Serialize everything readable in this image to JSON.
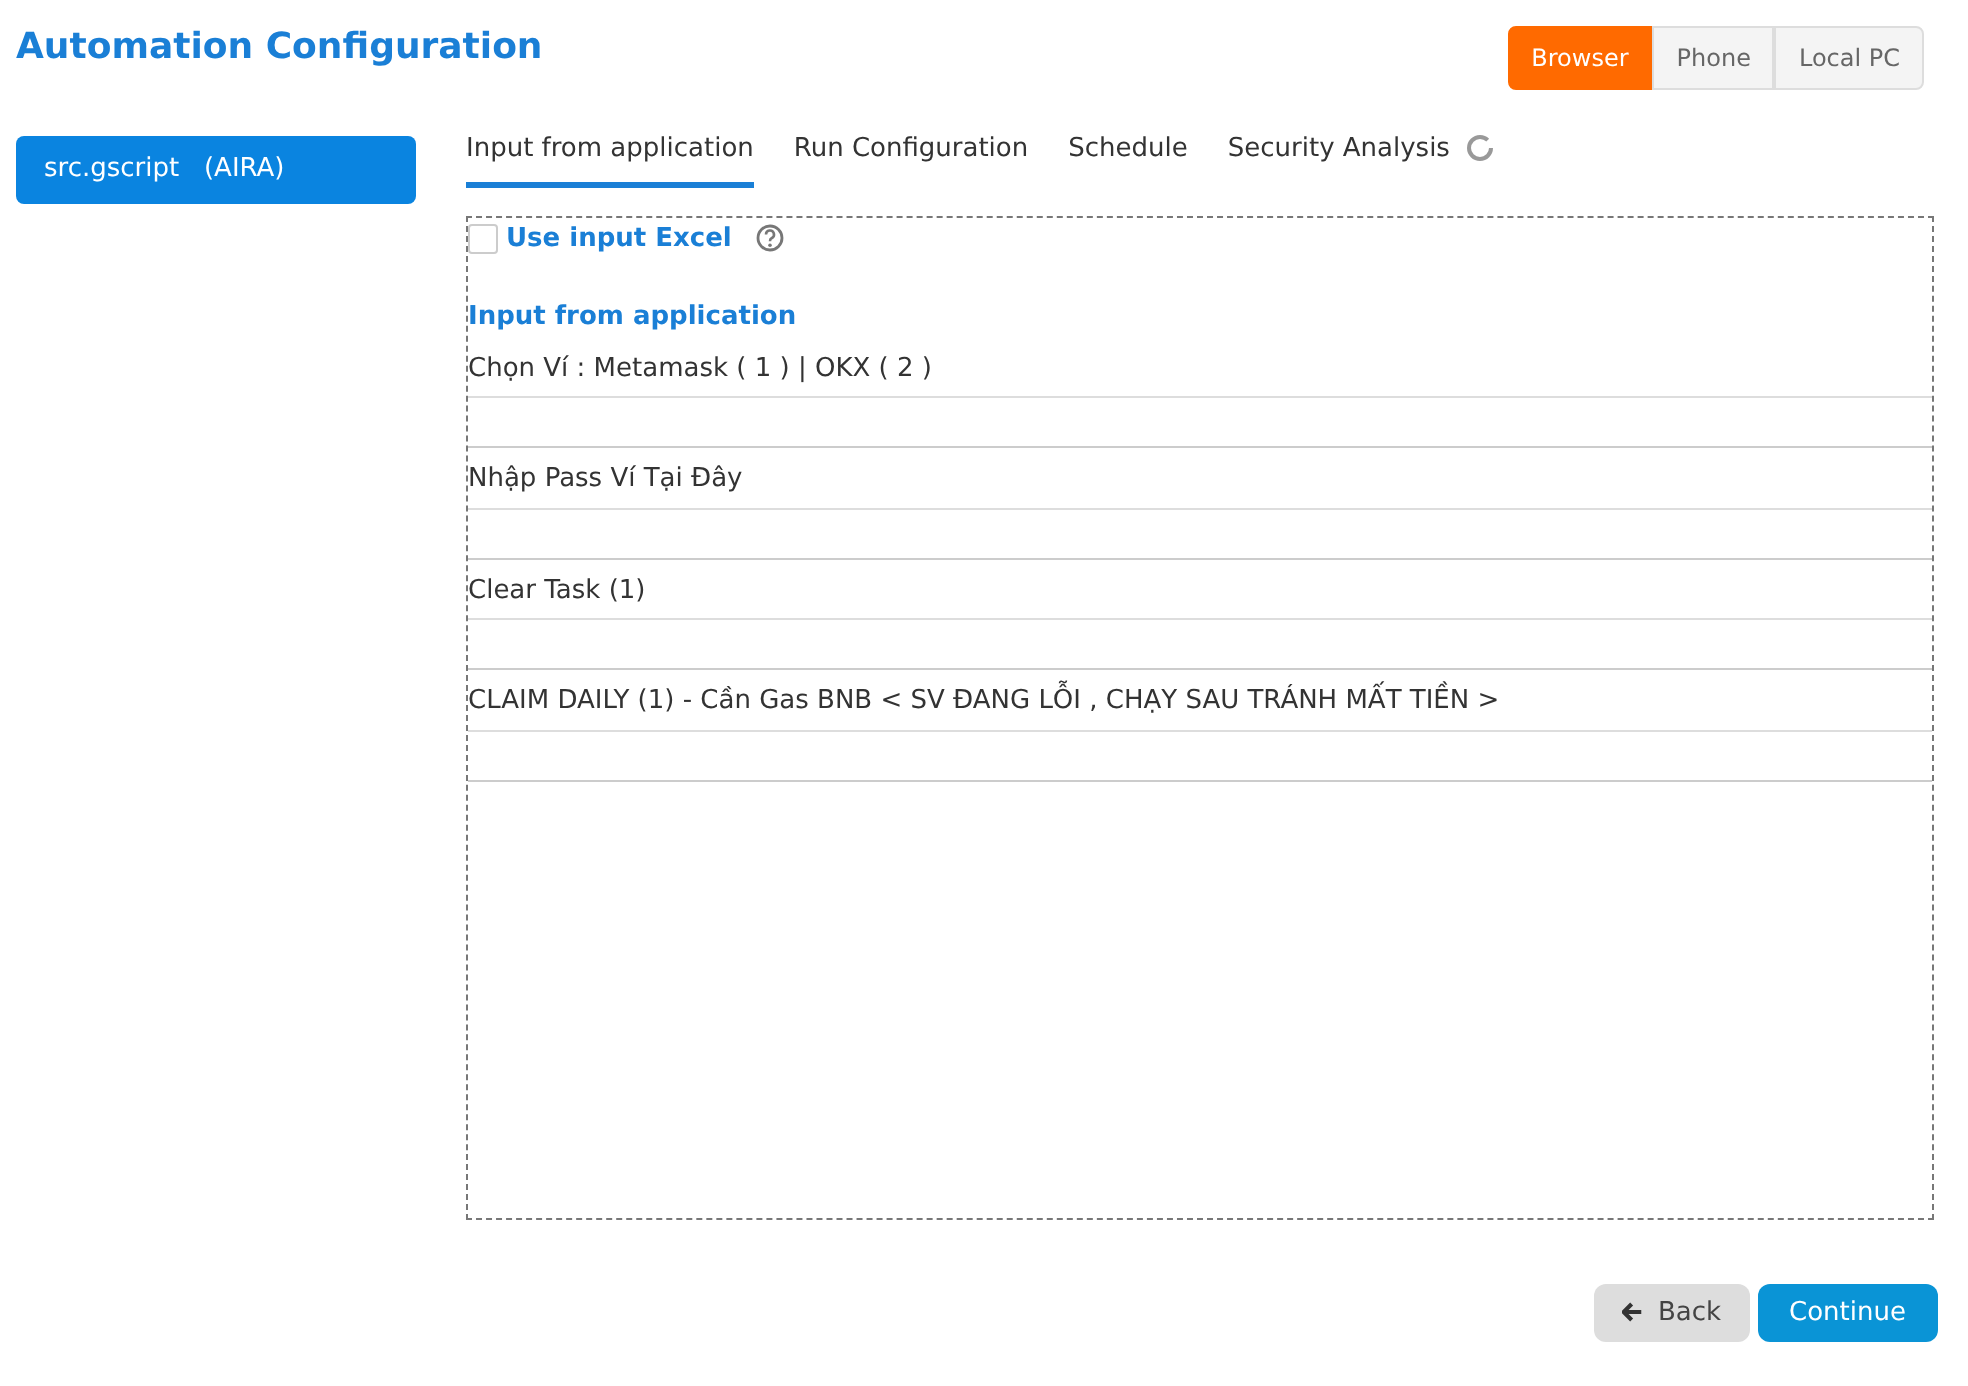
{
  "title": "Automation Configuration",
  "platforms": [
    {
      "label": "Browser",
      "selected": true
    },
    {
      "label": "Phone",
      "selected": false
    },
    {
      "label": "Local PC",
      "selected": false
    }
  ],
  "sidebar": {
    "items": [
      {
        "label": "src.gscript   (AIRA)",
        "selected": true
      }
    ]
  },
  "tabs": [
    {
      "label": "Input from application",
      "selected": true,
      "loading": false
    },
    {
      "label": "Run Configuration",
      "selected": false,
      "loading": false
    },
    {
      "label": "Schedule",
      "selected": false,
      "loading": false
    },
    {
      "label": "Security Analysis",
      "selected": false,
      "loading": true
    }
  ],
  "use_excel": {
    "label": "Use input Excel",
    "checked": false
  },
  "section_title": "Input from application",
  "fields": [
    {
      "label": "Chọn Ví : Metamask ( 1 ) | OKX ( 2 )"
    },
    {
      "label": "Nhập Pass Ví Tại Đây"
    },
    {
      "label": "Clear Task (1)"
    },
    {
      "label": "CLAIM DAILY (1) - Cần Gas BNB < SV ĐANG LỖI , CHẠY SAU TRÁNH MẤT TIỀN >"
    }
  ],
  "buttons": [
    {
      "label": "Back",
      "kind": "back"
    },
    {
      "label": "Continue",
      "kind": "primary"
    }
  ]
}
